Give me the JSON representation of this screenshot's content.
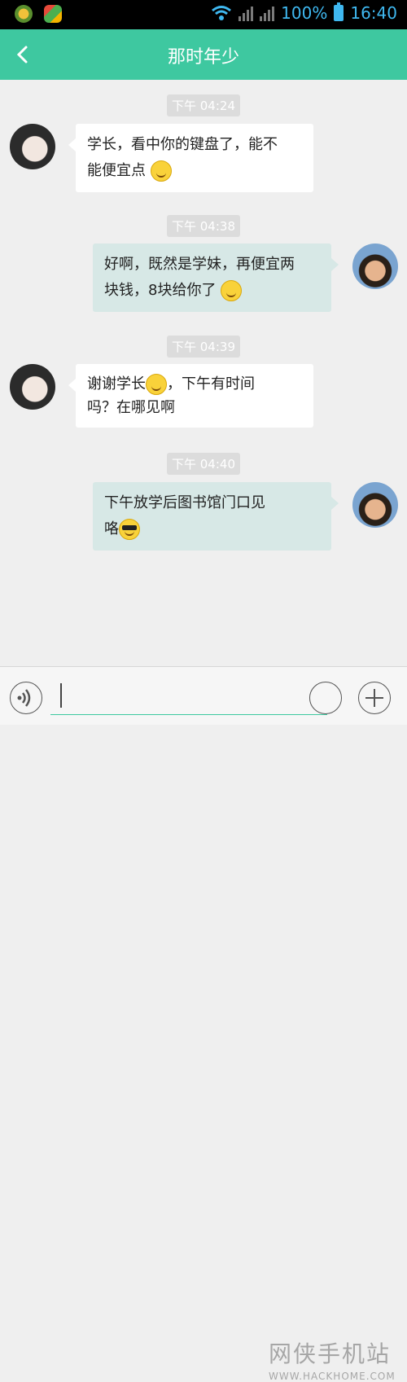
{
  "status_bar": {
    "battery": "100%",
    "time": "16:40",
    "icons": [
      "app-icon-1",
      "app-icon-2",
      "wifi-icon",
      "signal-icon-1",
      "signal-icon-2",
      "battery-icon"
    ]
  },
  "header": {
    "title": "那时年少",
    "back_icon": "chevron-left-icon"
  },
  "messages": [
    {
      "time": "下午 04:24",
      "side": "left",
      "lines": [
        "学长，看中你的键盘了，能不",
        "能便宜点"
      ],
      "emoji": "smile"
    },
    {
      "time": "下午 04:38",
      "side": "right",
      "lines": [
        "好啊，既然是学妹，再便宜两",
        "块钱，8块给你了"
      ],
      "emoji": "wink"
    },
    {
      "time": "下午 04:39",
      "side": "left",
      "lines": [
        "谢谢学长",
        "，下午有时间",
        "吗？在哪见啊"
      ],
      "emoji": "grin"
    },
    {
      "time": "下午 04:40",
      "side": "right",
      "lines": [
        "下午放学后图书馆门口见",
        "咯"
      ],
      "emoji": "cool"
    }
  ],
  "bottom_bar": {
    "voice_icon": "voice-icon",
    "input_value": "",
    "emoji_icon": "emoji-icon",
    "plus_icon": "plus-icon"
  },
  "watermark": {
    "text": "网侠手机站",
    "url": "WWW.HACKHOME.COM"
  },
  "colors": {
    "accent": "#3ec8a0",
    "right_bubble": "#d7e8e6",
    "left_bubble": "#ffffff"
  }
}
